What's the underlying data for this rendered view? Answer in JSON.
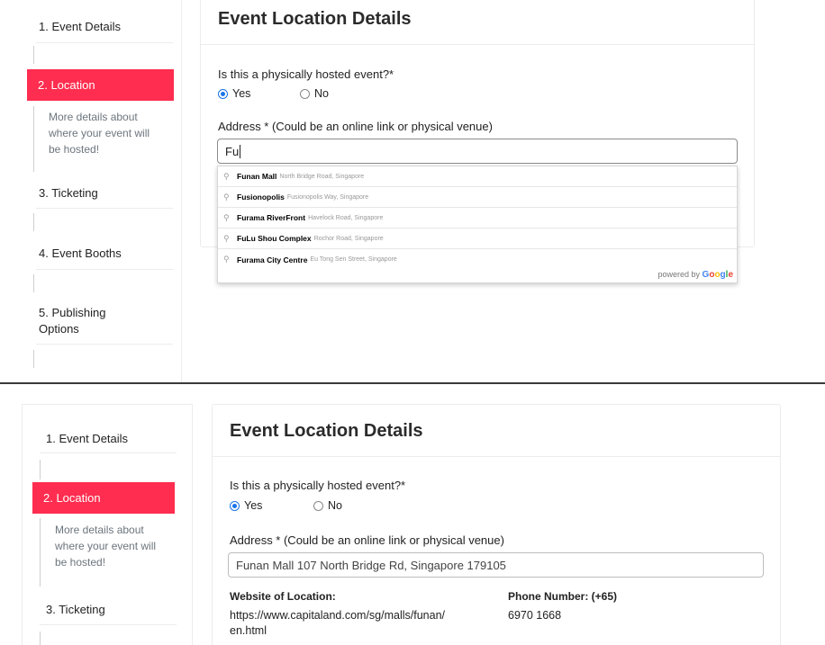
{
  "steps": {
    "s1": "1. Event Details",
    "s2": "2. Location",
    "s2_desc_1": "More details about",
    "s2_desc_2": "where your event will",
    "s2_desc_3": "be hosted!",
    "s3": "3. Ticketing",
    "s4": "4. Event Booths",
    "s5_line1": "5. Publishing",
    "s5_line2": "Options"
  },
  "card": {
    "title": "Event Location Details",
    "question": "Is this a physically hosted event?*",
    "yes": "Yes",
    "no": "No",
    "address_label": "Address * (Could be an online link or physical venue)"
  },
  "top": {
    "address_value": "Fu",
    "suggestions": [
      {
        "match": "Fu",
        "rest": "nan Mall",
        "secondary": "North Bridge Road, Singapore"
      },
      {
        "match": "Fu",
        "rest": "sionopolis",
        "secondary": "Fusionopolis Way, Singapore"
      },
      {
        "match": "Fu",
        "rest": "rama RiverFront",
        "secondary": "Havelock Road, Singapore"
      },
      {
        "match": "Fu",
        "rest": " Lu Shou Complex",
        "secondary": "Rochor Road, Singapore"
      },
      {
        "match": "Fu",
        "rest": "rama City Centre",
        "secondary": "Eu Tong Sen Street, Singapore"
      }
    ],
    "powered_by": "powered by",
    "google": "Google"
  },
  "bottom": {
    "address_value": "Funan Mall 107 North Bridge Rd, Singapore 179105",
    "website_label": "Website of Location:",
    "website_line1": "https://www.capitaland.com/sg/malls/funan/",
    "website_line2": "en.html",
    "phone_label": "Phone Number: (+65)",
    "phone_value": "6970 1668"
  },
  "colors": {
    "active_step": "#ff2d4f",
    "radio_checked": "#1a73e8"
  }
}
